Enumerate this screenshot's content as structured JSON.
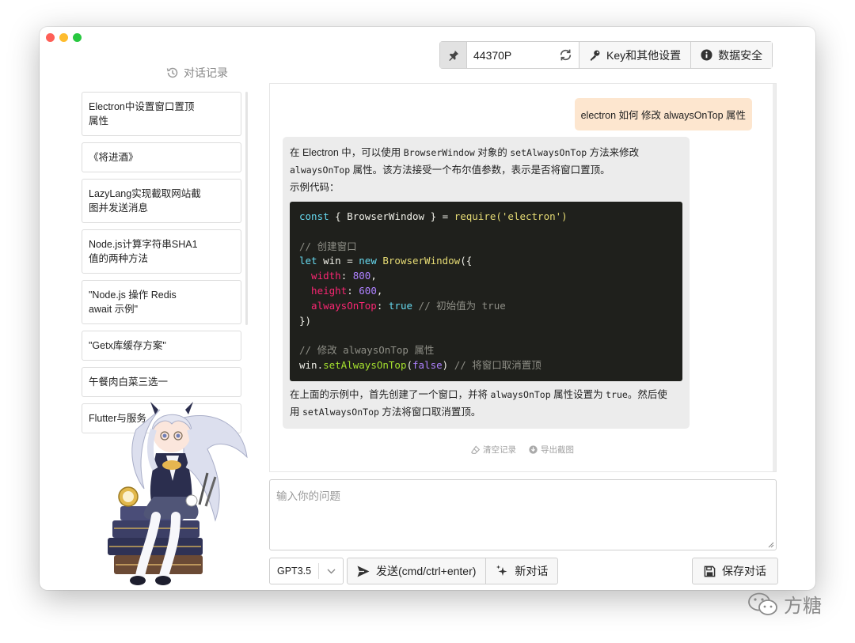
{
  "toolbar": {
    "key_value": "44370P",
    "settings_label": "Key和其他设置",
    "security_label": "数据安全"
  },
  "sidebar": {
    "title": "对话记录",
    "items": [
      {
        "line1": "Electron中设置窗口置顶",
        "line2": "属性"
      },
      {
        "line1": "《将进酒》",
        "line2": ""
      },
      {
        "line1": "LazyLang实现截取网站截",
        "line2": "图并发送消息"
      },
      {
        "line1": "Node.js计算字符串SHA1",
        "line2": "值的两种方法"
      },
      {
        "line1": "\"Node.js 操作 Redis",
        "line2": "await 示例\""
      },
      {
        "line1": "\"Getx库缓存方案\"",
        "line2": ""
      },
      {
        "line1": "午餐肉白菜三选一",
        "line2": ""
      },
      {
        "line1": "Flutter与服务",
        "line2": ""
      }
    ]
  },
  "chat": {
    "user_message": "electron 如何 修改 alwaysOnTop 属性",
    "bot": {
      "p1_a": "在 Electron 中，可以使用 ",
      "p1_code1": "BrowserWindow",
      "p1_b": " 对象的 ",
      "p1_code2": "setAlwaysOnTop",
      "p1_c": " 方法来修改",
      "p2_code": "alwaysOnTop",
      "p2_text": " 属性。该方法接受一个布尔值参数，表示是否将窗口置顶。",
      "p3": "示例代码：",
      "code": {
        "l1_kw": "const",
        "l1_rest": " { BrowserWindow } = ",
        "l1_fn": "require",
        "l1_str": "('electron')",
        "l3": "// 创建窗口",
        "l4_kw": "let",
        "l4_mid": " win = ",
        "l4_kw2": "new",
        "l4_fn": " BrowserWindow",
        "l4_end": "({",
        "l5_prop": "  width",
        "l5_num": "800",
        "l6_prop": "  height",
        "l6_num": "600",
        "l7_prop": "  alwaysOnTop",
        "l7_val": "true",
        "l7_cm": "// 初始值为 true",
        "l8": "})",
        "l10": "// 修改 alwaysOnTop 属性",
        "l11_a": "win.",
        "l11_call": "setAlwaysOnTop",
        "l11_b": "(",
        "l11_val": "false",
        "l11_c": ") ",
        "l11_cm": "// 将窗口取消置顶"
      },
      "p4_a": "在上面的示例中，首先创建了一个窗口，并将 ",
      "p4_code1": "alwaysOnTop",
      "p4_b": " 属性设置为 ",
      "p4_code2": "true",
      "p4_c": "。然后使",
      "p5_a": "用 ",
      "p5_code": "setAlwaysOnTop",
      "p5_b": " 方法将窗口取消置顶。"
    },
    "clear_label": "清空记录",
    "export_label": "导出截图"
  },
  "input": {
    "placeholder": "输入你的问题"
  },
  "controls": {
    "model": "GPT3.5",
    "send_label": "发送(cmd/ctrl+enter)",
    "new_chat_label": "新对话",
    "save_label": "保存对话"
  },
  "watermark": {
    "text": "方糖"
  },
  "colors": {
    "user_bubble": "#fde6cf",
    "bot_bubble": "#ececec",
    "code_bg": "#1f201c"
  }
}
